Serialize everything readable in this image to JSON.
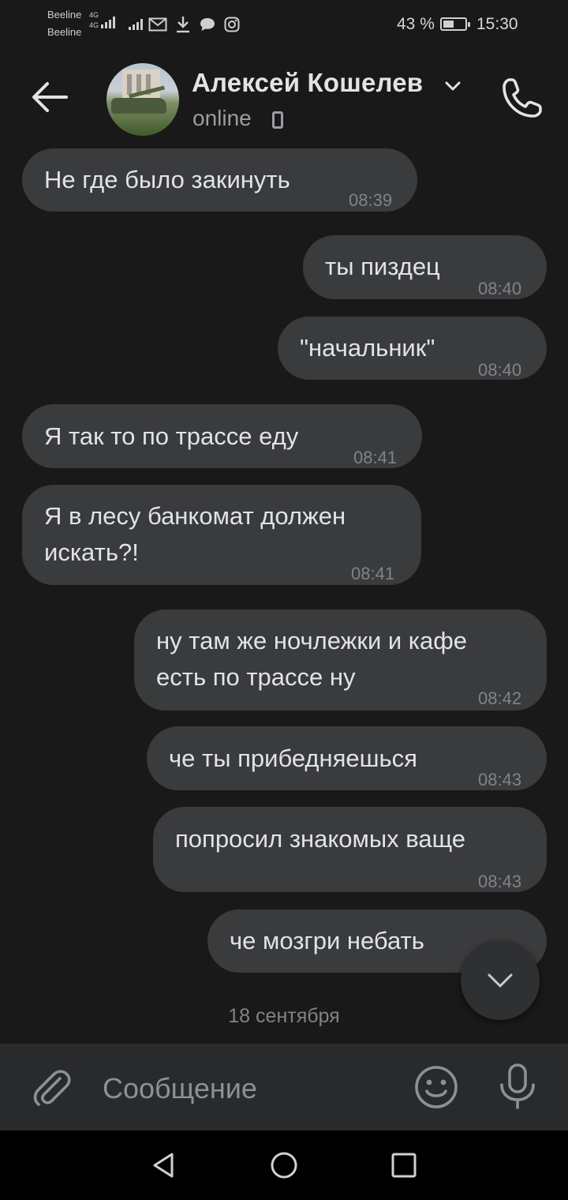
{
  "status_bar": {
    "operator_1": "Beeline",
    "operator_2": "Beeline",
    "network_1": "4G",
    "network_2": "4G",
    "battery_percent": "43 %",
    "battery_level": 0.43,
    "time": "15:30"
  },
  "header": {
    "contact_name": "Алексей Кошелев",
    "presence": "online"
  },
  "messages": [
    {
      "side": "in",
      "lines": [
        "Не где было закинуть"
      ],
      "time": "08:39"
    },
    {
      "side": "out",
      "lines": [
        "ты пиздец"
      ],
      "time": "08:40"
    },
    {
      "side": "out",
      "lines": [
        "\"начальник\""
      ],
      "time": "08:40"
    },
    {
      "side": "in",
      "lines": [
        "Я так то по трассе еду"
      ],
      "time": "08:41"
    },
    {
      "side": "in",
      "lines": [
        "Я в лесу банкомат должен",
        "искать?!"
      ],
      "time": "08:41"
    },
    {
      "side": "out",
      "lines": [
        "ну там же ночлежки и кафе",
        "есть по трассе ну"
      ],
      "time": "08:42"
    },
    {
      "side": "out",
      "lines": [
        "че ты прибедняешься"
      ],
      "time": "08:43"
    },
    {
      "side": "out",
      "lines": [
        "попросил знакомых ваще"
      ],
      "time": "08:43"
    },
    {
      "side": "out",
      "lines": [
        "че мозгри небать"
      ],
      "time": ""
    }
  ],
  "date_separator": "18 сентября",
  "composer": {
    "placeholder": "Сообщение"
  },
  "icons": {
    "back": "arrow-left-icon",
    "call": "phone-icon",
    "attach": "paperclip-icon",
    "emoji": "smiley-icon",
    "mic": "microphone-icon",
    "scroll_down": "chevron-down-icon"
  },
  "colors": {
    "background": "#191919",
    "bubble": "#3a3b3d",
    "text": "#e1e3e6",
    "muted": "#7f8388"
  }
}
